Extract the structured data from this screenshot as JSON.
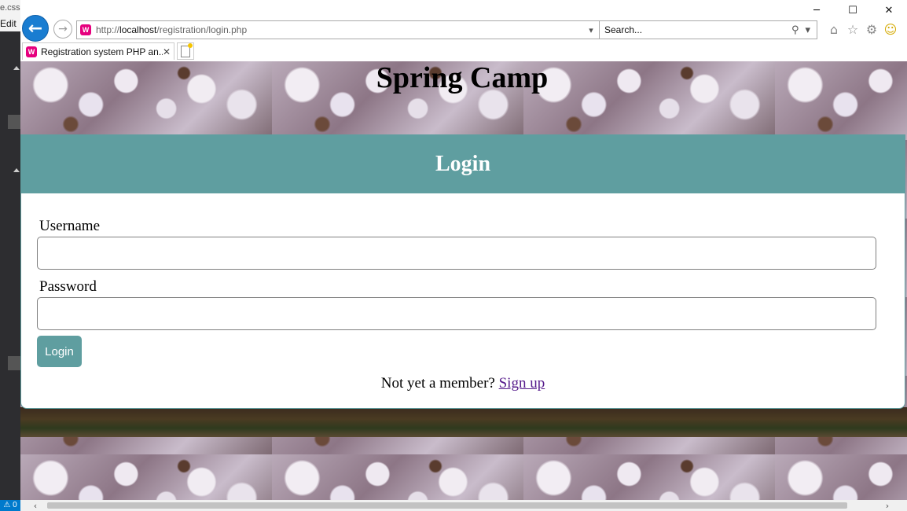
{
  "editor": {
    "tab1": "e.css",
    "tab2": "Edit",
    "status": "⚠ 0"
  },
  "window": {
    "minimize_icon": "minimize-icon",
    "maximize_icon": "maximize-icon",
    "close_icon": "close-icon"
  },
  "address_bar": {
    "url_prefix": "http://",
    "url_host": "localhost",
    "url_path": "/registration/login.php"
  },
  "search": {
    "placeholder": "Search..."
  },
  "tab": {
    "title": "Registration system PHP an..."
  },
  "page": {
    "title": "Spring Camp",
    "card_header": "Login",
    "username_label": "Username",
    "username_value": "",
    "password_label": "Password",
    "password_value": "",
    "login_button": "Login",
    "signup_prompt": "Not yet a member?",
    "signup_link": "Sign up"
  },
  "colors": {
    "accent": "#5f9ea0",
    "link_visited": "#551a8b",
    "back_button": "#1a7dd1"
  }
}
